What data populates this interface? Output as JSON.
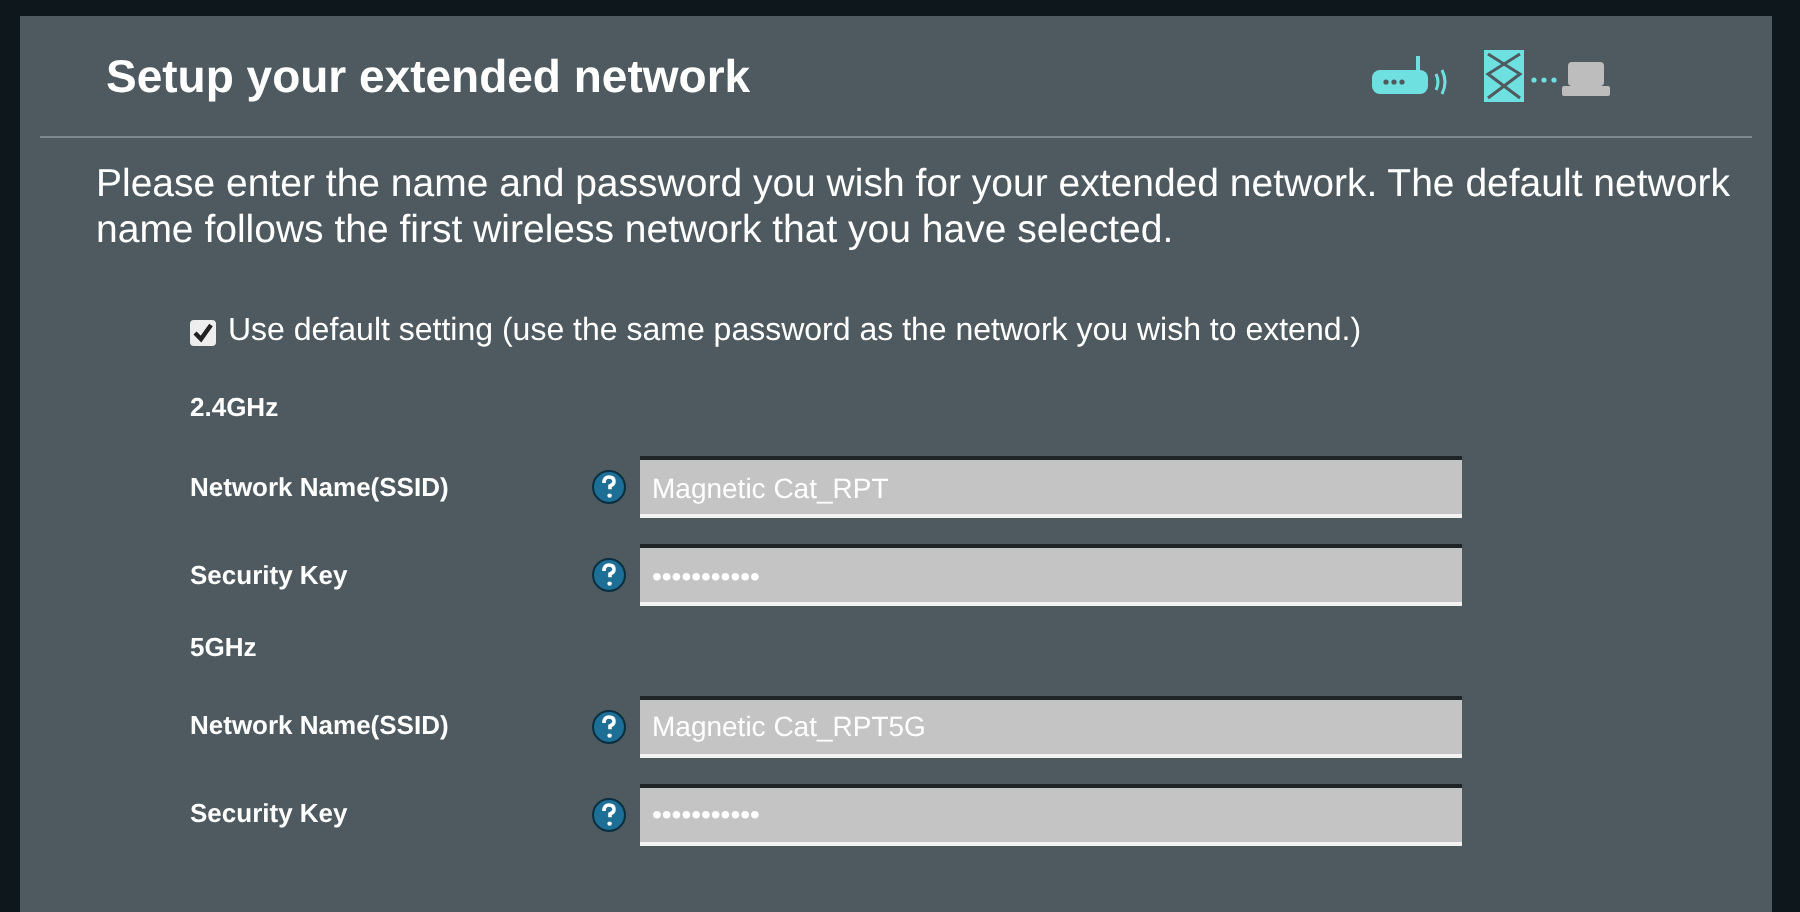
{
  "title": "Setup your extended network",
  "description": "Please enter the name and password you wish for your extended network. The default network name follows the first wireless network that you have selected.",
  "use_default": {
    "label": "Use default setting (use the same password as the network you wish to extend.)",
    "checked": true
  },
  "bands": [
    {
      "heading": "2.4GHz",
      "fields": [
        {
          "label": "Network Name(SSID)",
          "value": "Magnetic Cat_RPT"
        },
        {
          "label": "Security Key",
          "value": "•••••••••••"
        }
      ]
    },
    {
      "heading": "5GHz",
      "fields": [
        {
          "label": "Network Name(SSID)",
          "value": "Magnetic Cat_RPT5G"
        },
        {
          "label": "Security Key",
          "value": "•••••••••••"
        }
      ]
    }
  ]
}
